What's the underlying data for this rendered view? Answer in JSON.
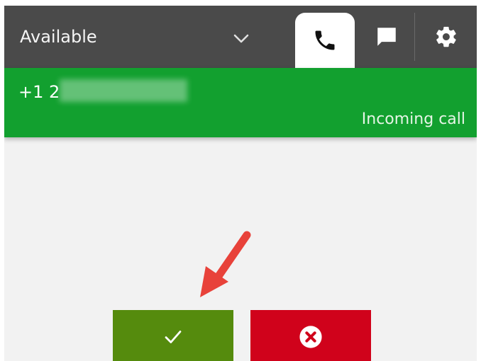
{
  "status": {
    "label": "Available"
  },
  "tabs": [
    {
      "icon": "phone-icon",
      "active": true
    },
    {
      "icon": "chat-icon",
      "active": false
    },
    {
      "icon": "gear-icon",
      "active": false
    }
  ],
  "call": {
    "number": "+1 2",
    "status_text": "Incoming call"
  },
  "actions": {
    "accept_icon": "checkmark-icon",
    "reject_icon": "close-circle-icon"
  },
  "colors": {
    "topbar": "#4a4a4a",
    "banner": "#12a02f",
    "accept": "#558b0d",
    "reject": "#d0021b",
    "arrow": "#e8423a",
    "background": "#f2f2f2"
  }
}
